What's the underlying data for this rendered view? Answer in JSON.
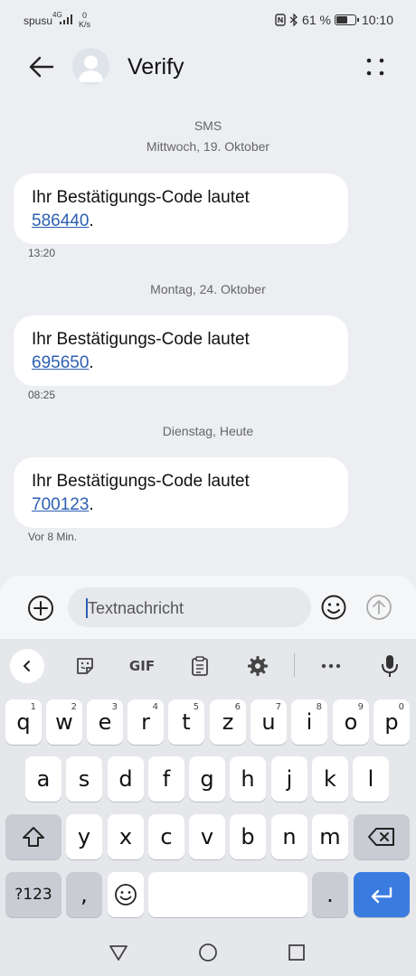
{
  "status_bar": {
    "carrier": "spusu",
    "network": "4G",
    "speed_value": "0",
    "speed_unit": "K/s",
    "battery": "61 %",
    "time": "10:10"
  },
  "header": {
    "title": "Verify"
  },
  "conversation": {
    "channel_label": "SMS",
    "groups": [
      {
        "date": "Mittwoch, 19. Oktober",
        "text": "Ihr Bestätigungs-Code lautet",
        "code": "586440",
        "suffix": ".",
        "time": "13:20"
      },
      {
        "date": "Montag, 24. Oktober",
        "text": "Ihr Bestätigungs-Code lautet",
        "code": "695650",
        "suffix": ".",
        "time": "08:25"
      },
      {
        "date": "Dienstag, Heute",
        "text": "Ihr Bestätigungs-Code lautet",
        "code": "700123",
        "suffix": ".",
        "time": "Vor 8 Min."
      }
    ]
  },
  "compose": {
    "placeholder": "Textnachricht"
  },
  "keyboard": {
    "toolbar": {
      "gif": "GIF"
    },
    "row1": [
      {
        "char": "q",
        "num": "1"
      },
      {
        "char": "w",
        "num": "2"
      },
      {
        "char": "e",
        "num": "3"
      },
      {
        "char": "r",
        "num": "4"
      },
      {
        "char": "t",
        "num": "5"
      },
      {
        "char": "z",
        "num": "6"
      },
      {
        "char": "u",
        "num": "7"
      },
      {
        "char": "i",
        "num": "8"
      },
      {
        "char": "o",
        "num": "9"
      },
      {
        "char": "p",
        "num": "0"
      }
    ],
    "row2": [
      "a",
      "s",
      "d",
      "f",
      "g",
      "h",
      "j",
      "k",
      "l"
    ],
    "row3": [
      "y",
      "x",
      "c",
      "v",
      "b",
      "n",
      "m"
    ],
    "symbols_label": "?123",
    "comma": ",",
    "period": "."
  },
  "colors": {
    "accent": "#2c5fb3",
    "enter_key": "#3a7be0",
    "background": "#eceef1"
  }
}
